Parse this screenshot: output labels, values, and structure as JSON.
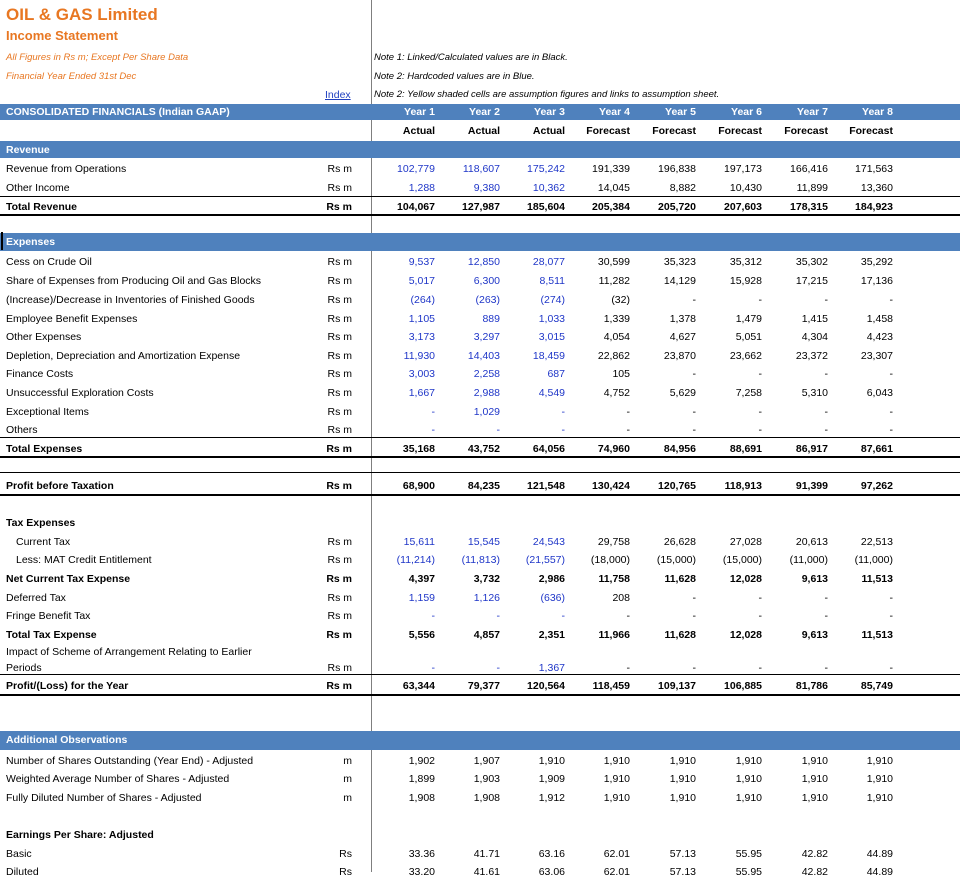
{
  "header": {
    "company": "OIL & GAS Limited",
    "statement": "Income Statement",
    "units_note": "All Figures in Rs m; Except Per Share Data",
    "fy_note": "Financial Year Ended 31st Dec",
    "index_link": "Index"
  },
  "notes": [
    "Note 1: Linked/Calculated values are in Black.",
    "Note 2: Hardcoded values are in Blue.",
    "Note 2: Yellow shaded cells are assumption figures and links to assumption sheet."
  ],
  "table_header": {
    "label": "CONSOLIDATED FINANCIALS (Indian GAAP)",
    "years": [
      "Year 1",
      "Year 2",
      "Year 3",
      "Year 4",
      "Year 5",
      "Year 6",
      "Year 7",
      "Year 8"
    ],
    "types": [
      "Actual",
      "Actual",
      "Actual",
      "Forecast",
      "Forecast",
      "Forecast",
      "Forecast",
      "Forecast"
    ]
  },
  "sections": {
    "revenue": "Revenue",
    "expenses": "Expenses",
    "additional": "Additional Observations"
  },
  "colors": {
    "band": "#4f81bd",
    "hardcoded": "#1f36c8",
    "title": "#e87722"
  },
  "rows": [
    {
      "id": "rev_ops",
      "label": "Revenue from Operations",
      "unit": "Rs m",
      "values": [
        "102,779",
        "118,607",
        "175,242",
        "191,339",
        "196,838",
        "197,173",
        "166,416",
        "171,563"
      ],
      "blue": 3
    },
    {
      "id": "other_income",
      "label": "Other Income",
      "unit": "Rs m",
      "values": [
        "1,288",
        "9,380",
        "10,362",
        "14,045",
        "8,882",
        "10,430",
        "11,899",
        "13,360"
      ],
      "blue": 3
    },
    {
      "id": "total_rev",
      "label": "Total Revenue",
      "unit": "Rs m",
      "values": [
        "104,067",
        "127,987",
        "185,604",
        "205,384",
        "205,720",
        "207,603",
        "178,315",
        "184,923"
      ],
      "bold": true
    },
    {
      "id": "cess",
      "label": "Cess on Crude Oil",
      "unit": "Rs m",
      "values": [
        "9,537",
        "12,850",
        "28,077",
        "30,599",
        "35,323",
        "35,312",
        "35,302",
        "35,292"
      ],
      "blue": 3
    },
    {
      "id": "share_exp",
      "label": "Share of Expenses from Producing Oil and Gas Blocks",
      "unit": "Rs m",
      "values": [
        "5,017",
        "6,300",
        "8,511",
        "11,282",
        "14,129",
        "15,928",
        "17,215",
        "17,136"
      ],
      "blue": 3
    },
    {
      "id": "inventory",
      "label": "(Increase)/Decrease in Inventories of Finished Goods",
      "unit": "Rs m",
      "values": [
        "(264)",
        "(263)",
        "(274)",
        "(32)",
        "-",
        "-",
        "-",
        "-"
      ],
      "blue": 3
    },
    {
      "id": "employee",
      "label": "Employee Benefit Expenses",
      "unit": "Rs m",
      "values": [
        "1,105",
        "889",
        "1,033",
        "1,339",
        "1,378",
        "1,479",
        "1,415",
        "1,458"
      ],
      "blue": 3
    },
    {
      "id": "other_exp",
      "label": "Other Expenses",
      "unit": "Rs m",
      "values": [
        "3,173",
        "3,297",
        "3,015",
        "4,054",
        "4,627",
        "5,051",
        "4,304",
        "4,423"
      ],
      "blue": 3
    },
    {
      "id": "dda",
      "label": "Depletion, Depreciation and Amortization Expense",
      "unit": "Rs m",
      "values": [
        "11,930",
        "14,403",
        "18,459",
        "22,862",
        "23,870",
        "23,662",
        "23,372",
        "23,307"
      ],
      "blue": 3
    },
    {
      "id": "finance",
      "label": "Finance Costs",
      "unit": "Rs m",
      "values": [
        "3,003",
        "2,258",
        "687",
        "105",
        "-",
        "-",
        "-",
        "-"
      ],
      "blue": 3
    },
    {
      "id": "unsuccessful",
      "label": "Unsuccessful Exploration Costs",
      "unit": "Rs m",
      "values": [
        "1,667",
        "2,988",
        "4,549",
        "4,752",
        "5,629",
        "7,258",
        "5,310",
        "6,043"
      ],
      "blue": 3
    },
    {
      "id": "exceptional",
      "label": "Exceptional Items",
      "unit": "Rs m",
      "values": [
        "-",
        "1,029",
        "-",
        "-",
        "-",
        "-",
        "-",
        "-"
      ],
      "blue": 3
    },
    {
      "id": "others",
      "label": "Others",
      "unit": "Rs m",
      "values": [
        "-",
        "-",
        "-",
        "-",
        "-",
        "-",
        "-",
        "-"
      ],
      "blue": 3
    },
    {
      "id": "total_exp",
      "label": "Total Expenses",
      "unit": "Rs m",
      "values": [
        "35,168",
        "43,752",
        "64,056",
        "74,960",
        "84,956",
        "88,691",
        "86,917",
        "87,661"
      ],
      "bold": true
    },
    {
      "id": "pbt",
      "label": "Profit before Taxation",
      "unit": "Rs m",
      "values": [
        "68,900",
        "84,235",
        "121,548",
        "130,424",
        "120,765",
        "118,913",
        "91,399",
        "97,262"
      ],
      "bold": true
    },
    {
      "id": "tax_hdr",
      "label": "Tax Expenses",
      "unit": "",
      "values": [
        "",
        "",
        "",
        "",
        "",
        "",
        "",
        ""
      ],
      "bold": true
    },
    {
      "id": "current_tax",
      "label": "Current Tax",
      "unit": "Rs m",
      "values": [
        "15,611",
        "15,545",
        "24,543",
        "29,758",
        "26,628",
        "27,028",
        "20,613",
        "22,513"
      ],
      "blue": 3,
      "indent": true
    },
    {
      "id": "mat",
      "label": "Less: MAT Credit Entitlement",
      "unit": "Rs m",
      "values": [
        "(11,214)",
        "(11,813)",
        "(21,557)",
        "(18,000)",
        "(15,000)",
        "(15,000)",
        "(11,000)",
        "(11,000)"
      ],
      "blue": 3,
      "indent": true
    },
    {
      "id": "net_current",
      "label": "Net Current Tax Expense",
      "unit": "Rs m",
      "values": [
        "4,397",
        "3,732",
        "2,986",
        "11,758",
        "11,628",
        "12,028",
        "9,613",
        "11,513"
      ],
      "bold": true
    },
    {
      "id": "deferred",
      "label": "Deferred Tax",
      "unit": "Rs m",
      "values": [
        "1,159",
        "1,126",
        "(636)",
        "208",
        "-",
        "-",
        "-",
        "-"
      ],
      "blue": 3
    },
    {
      "id": "fringe",
      "label": "Fringe Benefit Tax",
      "unit": "Rs m",
      "values": [
        "-",
        "-",
        "-",
        "-",
        "-",
        "-",
        "-",
        "-"
      ],
      "blue": 3
    },
    {
      "id": "total_tax",
      "label": "Total Tax Expense",
      "unit": "Rs m",
      "values": [
        "5,556",
        "4,857",
        "2,351",
        "11,966",
        "11,628",
        "12,028",
        "9,613",
        "11,513"
      ],
      "bold": true
    },
    {
      "id": "impact1",
      "label": "Impact of Scheme of Arrangement Relating to Earlier",
      "unit": "",
      "values": [
        "",
        "",
        "",
        "",
        "",
        "",
        "",
        ""
      ]
    },
    {
      "id": "impact2",
      "label": "Periods",
      "unit": "Rs m",
      "values": [
        "-",
        "-",
        "1,367",
        "-",
        "-",
        "-",
        "-",
        "-"
      ],
      "blue": 3
    },
    {
      "id": "pat",
      "label": "Profit/(Loss) for the Year",
      "unit": "Rs m",
      "values": [
        "63,344",
        "79,377",
        "120,564",
        "118,459",
        "109,137",
        "106,885",
        "81,786",
        "85,749"
      ],
      "bold": true
    },
    {
      "id": "shares_out",
      "label": "Number of Shares Outstanding (Year End) - Adjusted",
      "unit": "m",
      "values": [
        "1,902",
        "1,907",
        "1,910",
        "1,910",
        "1,910",
        "1,910",
        "1,910",
        "1,910"
      ]
    },
    {
      "id": "wavg",
      "label": "Weighted Average Number of Shares - Adjusted",
      "unit": "m",
      "values": [
        "1,899",
        "1,903",
        "1,909",
        "1,910",
        "1,910",
        "1,910",
        "1,910",
        "1,910"
      ]
    },
    {
      "id": "diluted_shares",
      "label": "Fully Diluted Number of Shares - Adjusted",
      "unit": "m",
      "values": [
        "1,908",
        "1,908",
        "1,912",
        "1,910",
        "1,910",
        "1,910",
        "1,910",
        "1,910"
      ]
    },
    {
      "id": "eps_hdr",
      "label": "Earnings Per Share: Adjusted",
      "unit": "",
      "values": [
        "",
        "",
        "",
        "",
        "",
        "",
        "",
        ""
      ],
      "bold": true
    },
    {
      "id": "basic",
      "label": "Basic",
      "unit": "Rs",
      "values": [
        "33.36",
        "41.71",
        "63.16",
        "62.01",
        "57.13",
        "55.95",
        "42.82",
        "44.89"
      ]
    },
    {
      "id": "diluted",
      "label": "Diluted",
      "unit": "Rs",
      "values": [
        "33.20",
        "41.61",
        "63.06",
        "62.01",
        "57.13",
        "55.95",
        "42.82",
        "44.89"
      ]
    }
  ]
}
